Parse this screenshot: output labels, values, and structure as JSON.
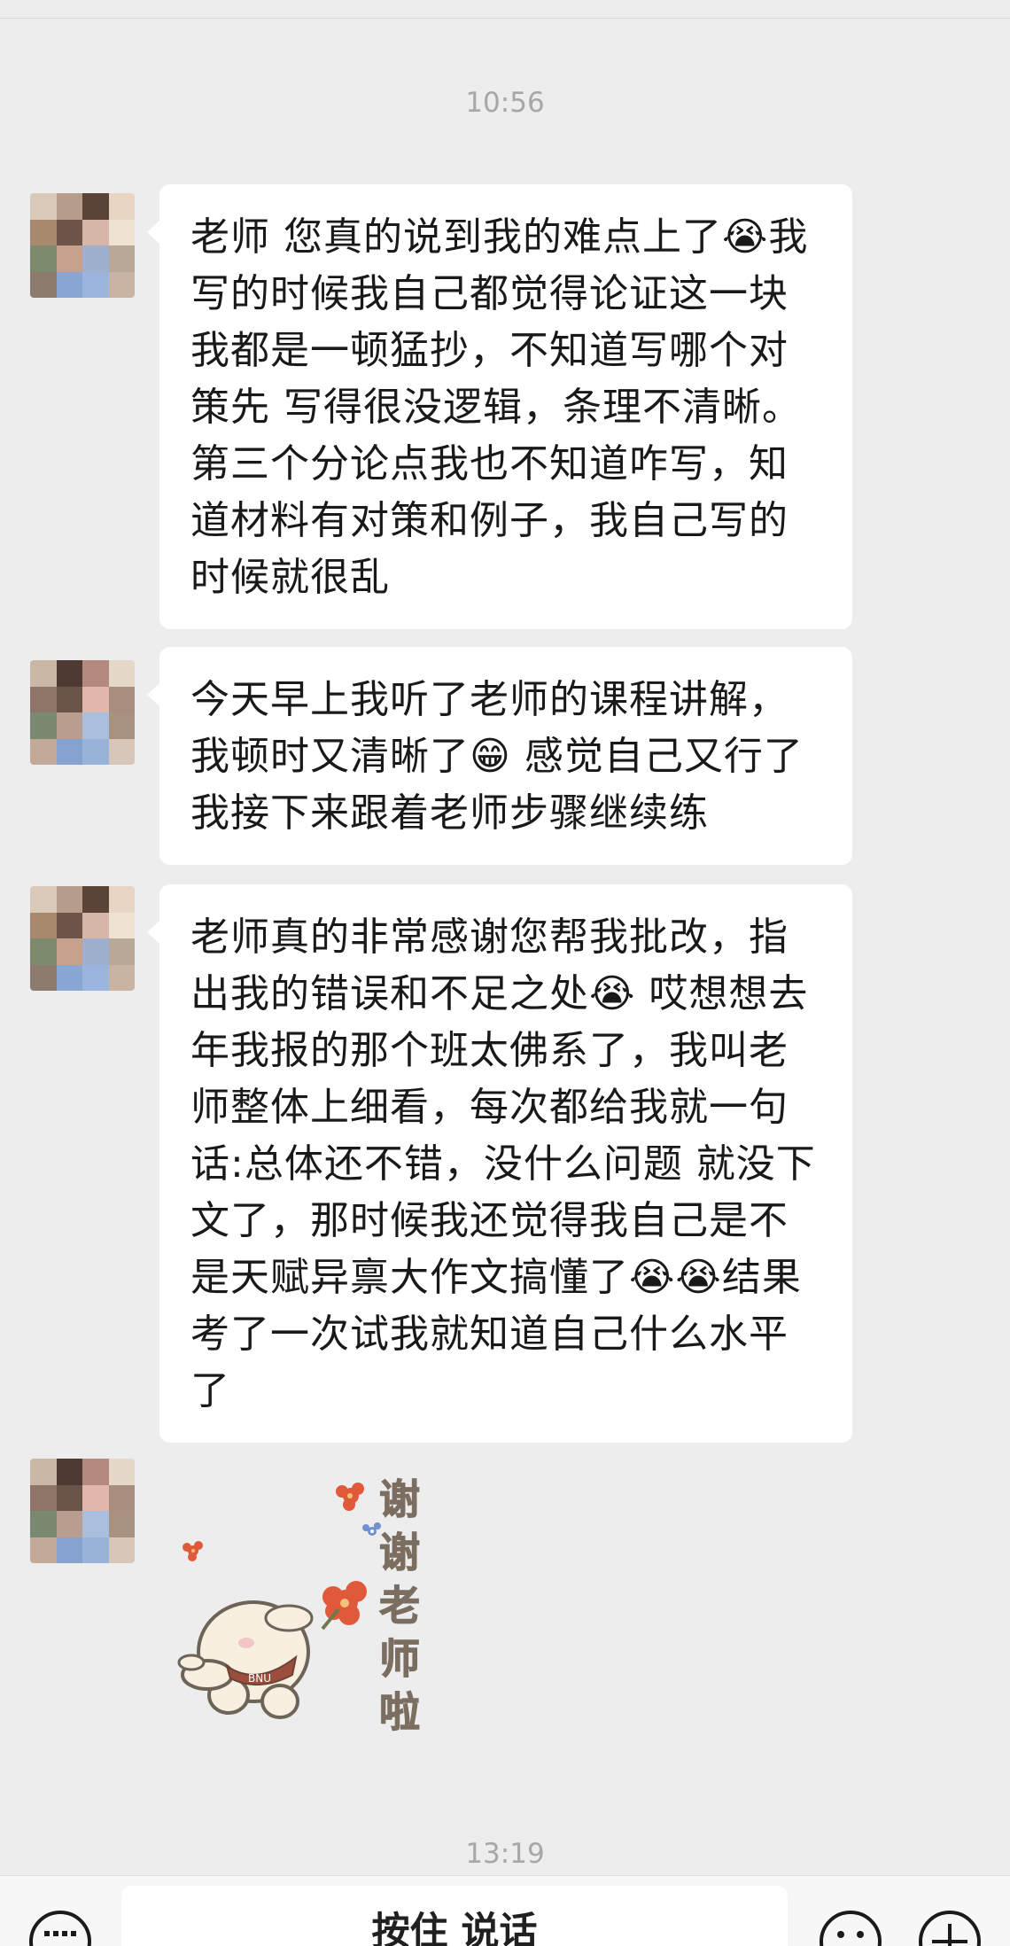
{
  "chat": {
    "timestamps": [
      "10:56",
      "13:19"
    ],
    "messages": [
      "老师 您真的说到我的难点上了😭我写的时候我自己都觉得论证这一块我都是一顿猛抄，不知道写哪个对策先 写得很没逻辑，条理不清晰。 第三个分论点我也不知道咋写，知道材料有对策和例子，我自己写的时候就很乱",
      "今天早上我听了老师的课程讲解，我顿时又清晰了😁 感觉自己又行了  我接下来跟着老师步骤继续练",
      "老师真的非常感谢您帮我批改，指出我的错误和不足之处😭 哎想想去年我报的那个班太佛系了，我叫老师整体上细看，每次都给我就一句话:总体还不错，没什么问题 就没下文了，那时候我还觉得我自己是不是天赋异禀大作文搞懂了😭😭结果考了一次试我就知道自己什么水平了"
    ],
    "sticker": {
      "text_chars": [
        "谢",
        "谢",
        "老",
        "师",
        "啦"
      ],
      "badge": "BNU"
    }
  },
  "input_bar": {
    "hold_to_talk_label": "按住 说话",
    "icons": [
      "keyboard-icon",
      "emoji-icon",
      "plus-icon"
    ]
  },
  "colors": {
    "background": "#ededed",
    "bubble": "#ffffff",
    "text": "#191919",
    "timestamp": "#a7a7a7"
  }
}
